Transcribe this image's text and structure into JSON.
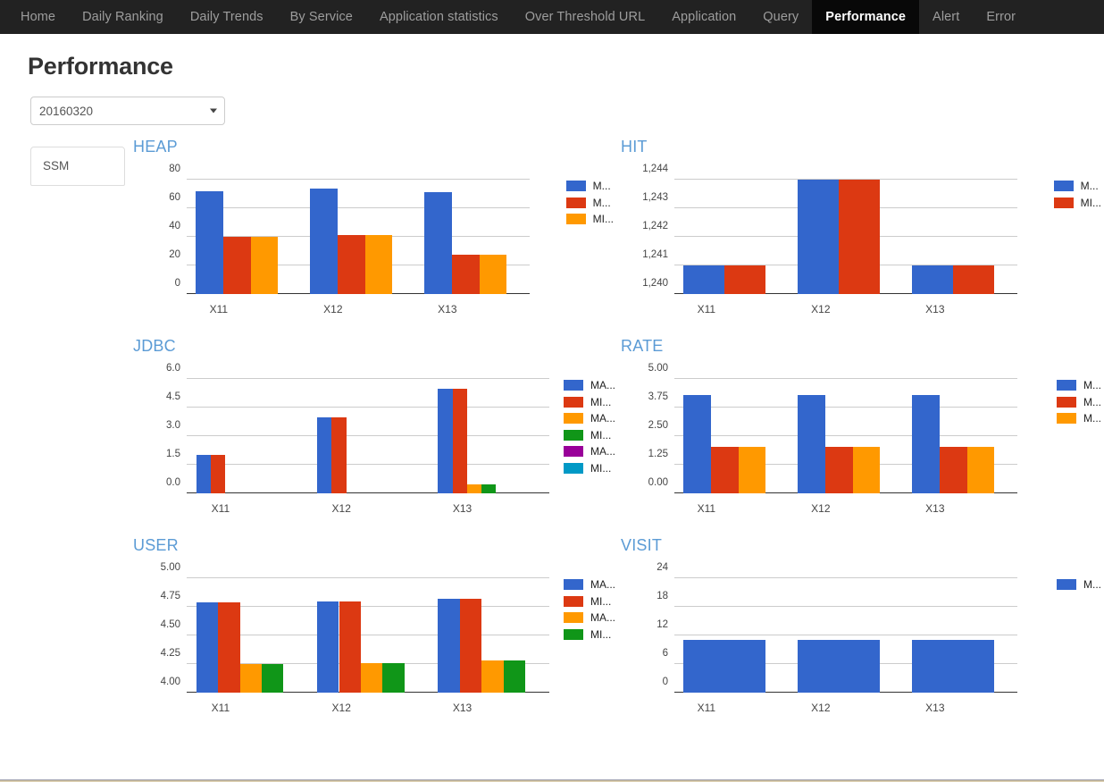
{
  "nav": {
    "items": [
      {
        "label": "Home",
        "active": false
      },
      {
        "label": "Daily Ranking",
        "active": false
      },
      {
        "label": "Daily Trends",
        "active": false
      },
      {
        "label": "By Service",
        "active": false
      },
      {
        "label": "Application statistics",
        "active": false
      },
      {
        "label": "Over Threshold URL",
        "active": false
      },
      {
        "label": "Application",
        "active": false
      },
      {
        "label": "Query",
        "active": false
      },
      {
        "label": "Performance",
        "active": true
      },
      {
        "label": "Alert",
        "active": false
      },
      {
        "label": "Error",
        "active": false
      }
    ]
  },
  "page": {
    "title": "Performance"
  },
  "date_select": {
    "value": "20160320",
    "options": [
      "20160320"
    ],
    "caret_icon": "chevron-down-icon"
  },
  "app_list": {
    "items": [
      "SSM"
    ],
    "selected": "SSM"
  },
  "colors": {
    "series": [
      "#3366cc",
      "#dc3912",
      "#ff9900",
      "#109618",
      "#990099",
      "#0099c6"
    ],
    "title": "#5b9bd5",
    "navbar_bg": "#222222",
    "navbar_active_bg": "#080808",
    "grid": "#cccccc",
    "axis": "#333333"
  },
  "chart_data": [
    {
      "type": "bar",
      "title": "HEAP",
      "categories": [
        "X11",
        "X12",
        "X13"
      ],
      "ylim": [
        0,
        80
      ],
      "yticks": [
        0,
        20,
        40,
        60,
        80
      ],
      "yticklabels": [
        "0",
        "20",
        "40",
        "60",
        "80"
      ],
      "grid": true,
      "legend_position": "right",
      "xlabel": "",
      "ylabel": "",
      "slot_series": 3,
      "series": [
        {
          "name": "M...",
          "color": "#3366cc",
          "values": [
            72,
            74,
            71
          ]
        },
        {
          "name": "M...",
          "color": "#dc3912",
          "values": [
            40,
            41,
            27.5
          ]
        },
        {
          "name": "MI...",
          "color": "#ff9900",
          "values": [
            40,
            41,
            27.5
          ]
        }
      ]
    },
    {
      "type": "bar",
      "title": "HIT",
      "categories": [
        "X11",
        "X12",
        "X13"
      ],
      "ylim": [
        1240,
        1244
      ],
      "yticks": [
        1240,
        1241,
        1242,
        1243,
        1244
      ],
      "yticklabels": [
        "1,240",
        "1,241",
        "1,242",
        "1,243",
        "1,244"
      ],
      "grid": true,
      "legend_position": "right",
      "xlabel": "",
      "ylabel": "",
      "slot_series": 2,
      "series": [
        {
          "name": "M...",
          "color": "#3366cc",
          "values": [
            1241,
            1244,
            1241
          ]
        },
        {
          "name": "MI...",
          "color": "#dc3912",
          "values": [
            1241,
            1244,
            1241
          ]
        }
      ]
    },
    {
      "type": "bar",
      "title": "JDBC",
      "categories": [
        "X11",
        "X12",
        "X13"
      ],
      "ylim": [
        0,
        6
      ],
      "yticks": [
        0,
        1.5,
        3,
        4.5,
        6
      ],
      "yticklabels": [
        "0.0",
        "1.5",
        "3.0",
        "4.5",
        "6.0"
      ],
      "grid": true,
      "legend_position": "right",
      "xlabel": "",
      "ylabel": "",
      "slot_series": 6,
      "series": [
        {
          "name": "MA...",
          "color": "#3366cc",
          "values": [
            2.0,
            4.0,
            5.5
          ]
        },
        {
          "name": "MI...",
          "color": "#dc3912",
          "values": [
            2.0,
            4.0,
            5.5
          ]
        },
        {
          "name": "MA...",
          "color": "#ff9900",
          "values": [
            0,
            0,
            0.45
          ]
        },
        {
          "name": "MI...",
          "color": "#109618",
          "values": [
            0,
            0,
            0.45
          ]
        },
        {
          "name": "MA...",
          "color": "#990099",
          "values": [
            0,
            0,
            0
          ]
        },
        {
          "name": "MI...",
          "color": "#0099c6",
          "values": [
            0,
            0,
            0
          ]
        }
      ]
    },
    {
      "type": "bar",
      "title": "RATE",
      "categories": [
        "X11",
        "X12",
        "X13"
      ],
      "ylim": [
        0,
        5
      ],
      "yticks": [
        0,
        1.25,
        2.5,
        3.75,
        5
      ],
      "yticklabels": [
        "0.00",
        "1.25",
        "2.50",
        "3.75",
        "5.00"
      ],
      "grid": true,
      "legend_position": "right",
      "xlabel": "",
      "ylabel": "",
      "slot_series": 3,
      "series": [
        {
          "name": "M...",
          "color": "#3366cc",
          "values": [
            4.28,
            4.3,
            4.3
          ]
        },
        {
          "name": "M...",
          "color": "#dc3912",
          "values": [
            2.04,
            2.04,
            2.04
          ]
        },
        {
          "name": "M...",
          "color": "#ff9900",
          "values": [
            2.04,
            2.04,
            2.04
          ]
        }
      ]
    },
    {
      "type": "bar",
      "title": "USER",
      "categories": [
        "X11",
        "X12",
        "X13"
      ],
      "ylim": [
        4.0,
        5.0
      ],
      "yticks": [
        4.0,
        4.25,
        4.5,
        4.75,
        5.0
      ],
      "yticklabels": [
        "4.00",
        "4.25",
        "4.50",
        "4.75",
        "5.00"
      ],
      "grid": true,
      "legend_position": "right",
      "xlabel": "",
      "ylabel": "",
      "slot_series": 4,
      "series": [
        {
          "name": "MA...",
          "color": "#3366cc",
          "values": [
            4.79,
            4.8,
            4.82
          ]
        },
        {
          "name": "MI...",
          "color": "#dc3912",
          "values": [
            4.79,
            4.8,
            4.82
          ]
        },
        {
          "name": "MA...",
          "color": "#ff9900",
          "values": [
            4.25,
            4.26,
            4.28
          ]
        },
        {
          "name": "MI...",
          "color": "#109618",
          "values": [
            4.25,
            4.26,
            4.28
          ]
        }
      ]
    },
    {
      "type": "bar",
      "title": "VISIT",
      "categories": [
        "X11",
        "X12",
        "X13"
      ],
      "ylim": [
        0,
        24
      ],
      "yticks": [
        0,
        6,
        12,
        18,
        24
      ],
      "yticklabels": [
        "0",
        "6",
        "12",
        "18",
        "24"
      ],
      "grid": true,
      "legend_position": "right",
      "xlabel": "",
      "ylabel": "",
      "slot_series": 1,
      "series": [
        {
          "name": "M...",
          "color": "#3366cc",
          "values": [
            11,
            11,
            11
          ]
        }
      ]
    }
  ]
}
